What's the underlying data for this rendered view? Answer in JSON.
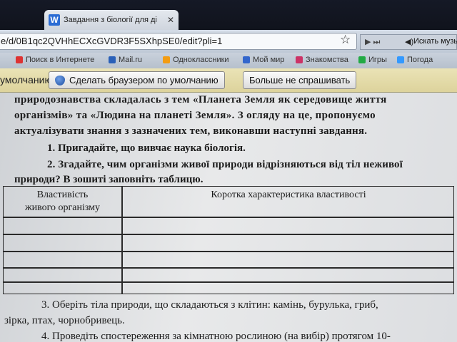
{
  "browser": {
    "tab_title": "Завдання з біології для ді",
    "tab_favicon_letter": "W",
    "tab_close": "✕",
    "address": "e/d/0B1qc2QVHhECXcGVDR3F5SXhpSE0/edit?pli=1",
    "star": "☆",
    "yabar_play": "▶ ⏭",
    "yabar_speaker": "◀)",
    "yabar_music": "Искать музы"
  },
  "bookmarks": [
    {
      "label": "Поиск в Интернете",
      "color": "#d33"
    },
    {
      "label": "Mail.ru",
      "color": "#2a60b8"
    },
    {
      "label": "Одноклассники",
      "color": "#f39c12"
    },
    {
      "label": "Мой мир",
      "color": "#3366cc"
    },
    {
      "label": "Знакомства",
      "color": "#cc3366"
    },
    {
      "label": "Игры",
      "color": "#22aa44"
    },
    {
      "label": "Погода",
      "color": "#3399ff"
    }
  ],
  "infobar": {
    "text": "умолчанию",
    "make_default_label": "Сделать браузером по умолчанию",
    "dont_ask_label": "Больше не спрашивать"
  },
  "document": {
    "line1": "природознавства складалась з тем «Планета Земля як середовище життя",
    "line2": "організмів» та «Людина на планеті Земля». З огляду на це, пропонуємо",
    "line3": "актуалізувати знання з зазначених тем, виконавши наступні завдання.",
    "task1": "1. Пригадайте, що вивчає наука біологія.",
    "task2a": "2. Згадайте, чим організми живої природи відрізняються від тіл неживої",
    "task2b": "природи? В зошиті заповніть таблицю.",
    "table": {
      "col1_line1": "Властивість",
      "col1_line2": "живого організму",
      "col2": "Коротка характеристика властивості"
    },
    "task3a": "3. Оберіть тіла природи, що складаються з клітин: камінь, бурулька, гриб,",
    "task3b": "зірка, птах, чорнобривець.",
    "task4": "4. Проведіть спостереження за кімнатною рослиною (на вибір) протягом 10-"
  }
}
